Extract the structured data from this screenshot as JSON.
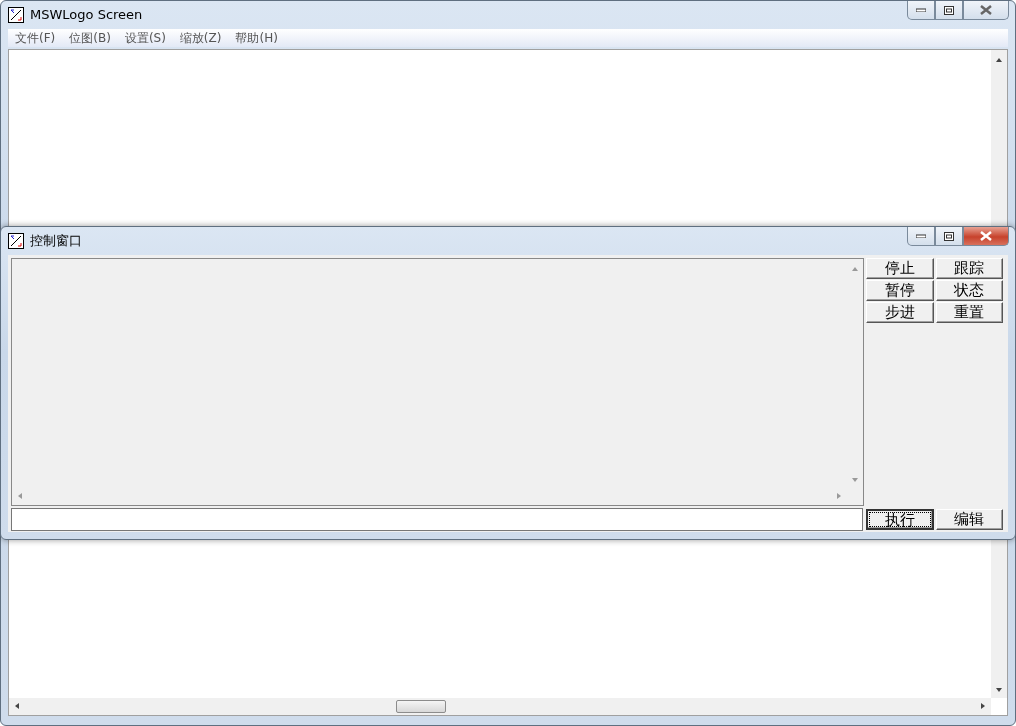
{
  "main_window": {
    "title": "MSWLogo Screen",
    "menu": [
      "文件(F)",
      "位图(B)",
      "设置(S)",
      "缩放(Z)",
      "帮助(H)"
    ]
  },
  "control_window": {
    "title": "控制窗口",
    "side_buttons": [
      {
        "label": "停止"
      },
      {
        "label": "跟踪"
      },
      {
        "label": "暂停"
      },
      {
        "label": "状态"
      },
      {
        "label": "步进"
      },
      {
        "label": "重置"
      }
    ],
    "bottom_buttons": [
      {
        "label": "执行",
        "focused": true
      },
      {
        "label": "编辑",
        "focused": false
      }
    ]
  }
}
